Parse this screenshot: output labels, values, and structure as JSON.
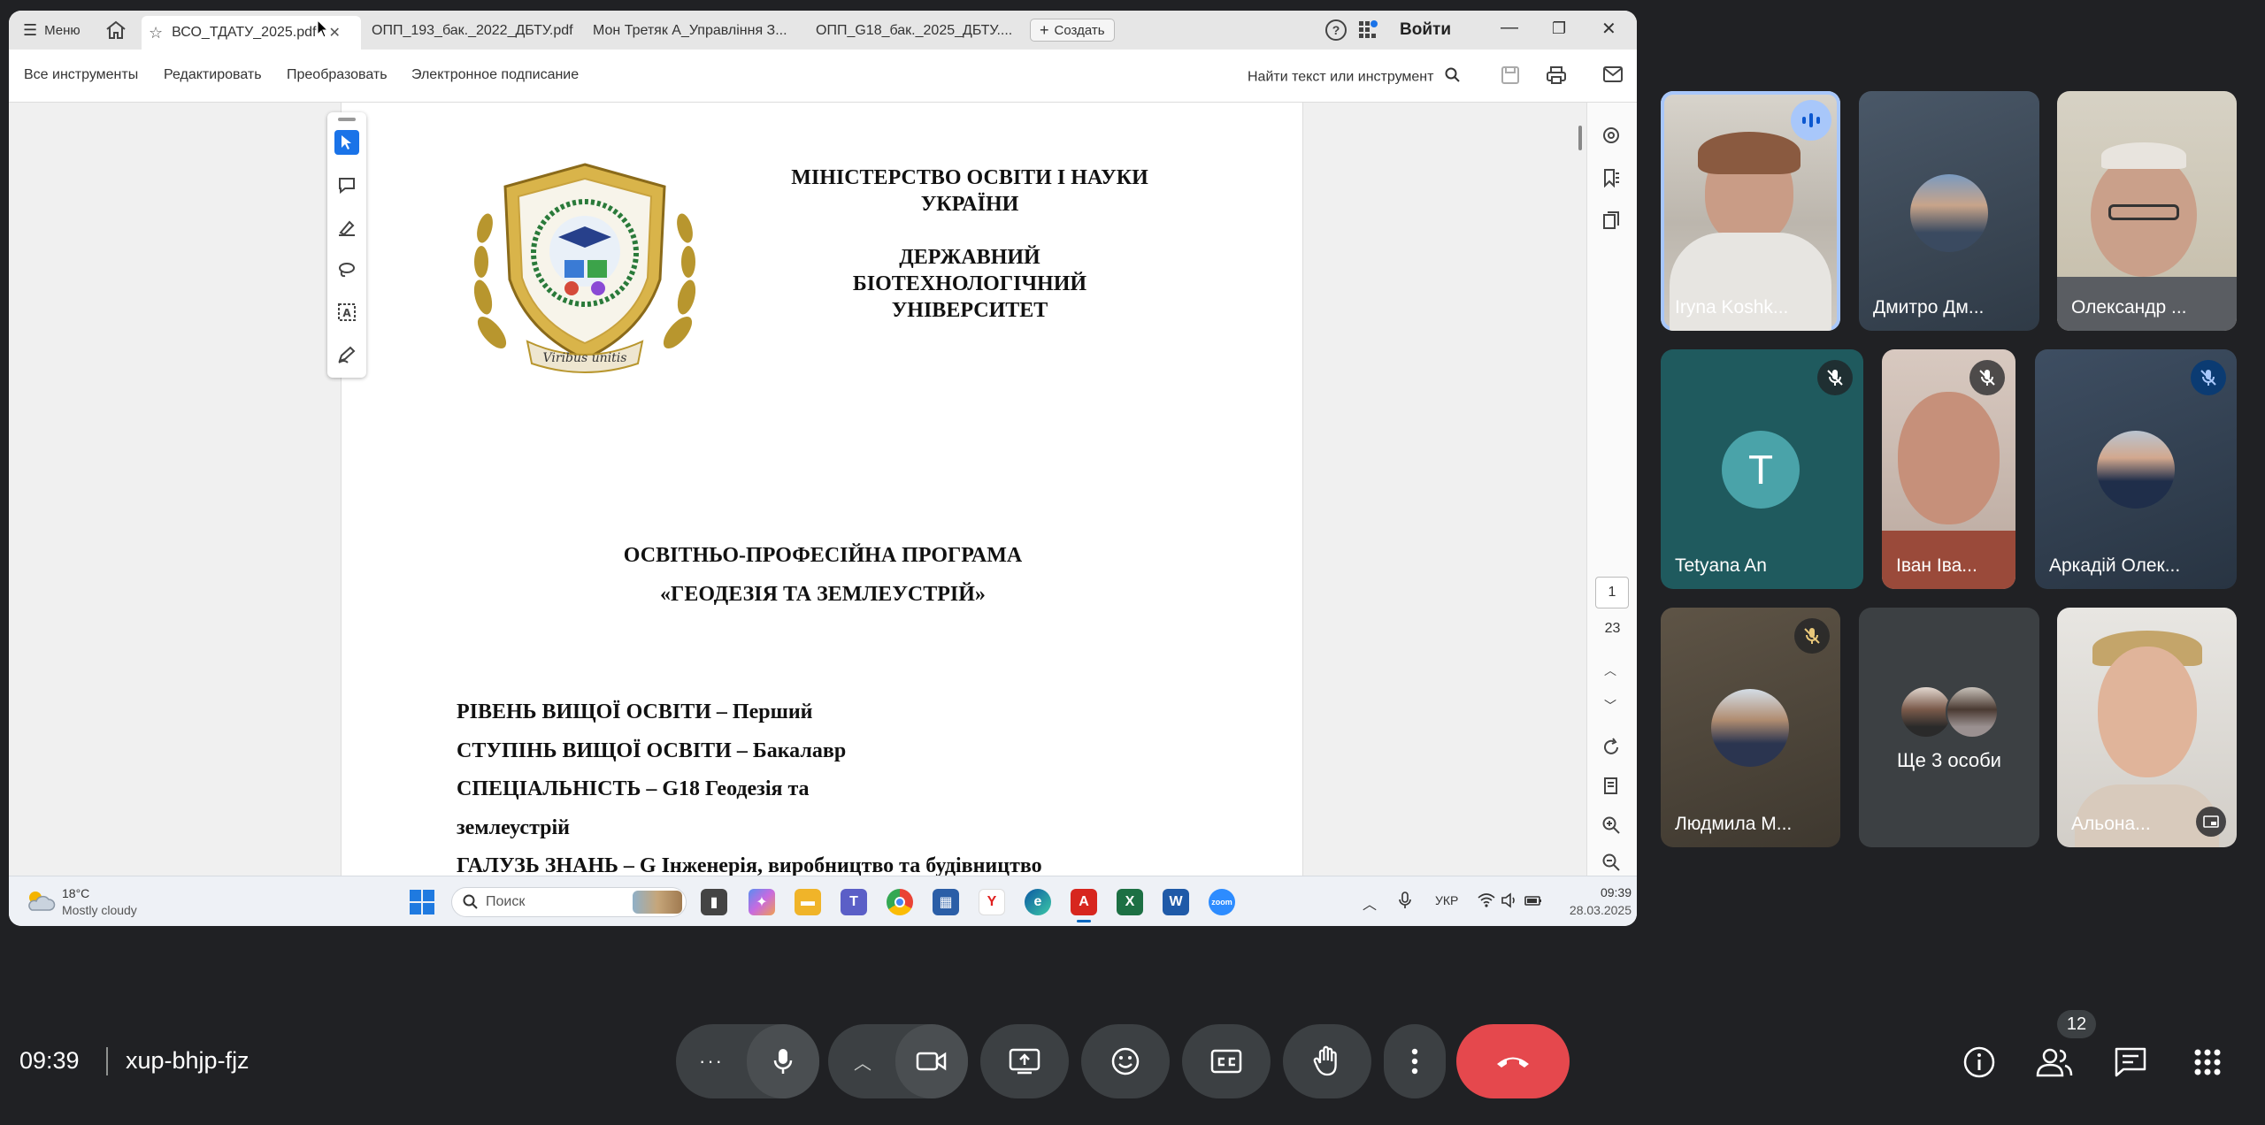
{
  "window": {
    "menu_label": "Меню",
    "tabs": [
      {
        "label": "ВСО_ТДАТУ_2025.pdf"
      },
      {
        "label": "ОПП_193_бак._2022_ДБТУ.pdf"
      },
      {
        "label": "Мон Третяк А_Управління З..."
      },
      {
        "label": "ОПП_G18_бак._2025_ДБТУ...."
      }
    ],
    "create_label": "Создать",
    "signin_label": "Войти"
  },
  "toolbar": {
    "items": [
      "Все инструменты",
      "Редактировать",
      "Преобразовать",
      "Электронное подписание"
    ],
    "search_label": "Найти текст или инструмент"
  },
  "document": {
    "logo_motto": "Viribus unitis",
    "ministry_lines": [
      "МІНІСТЕРСТВО ОСВІТИ І НАУКИ",
      "УКРАЇНИ"
    ],
    "university_lines": [
      "ДЕРЖАВНИЙ",
      "БІОТЕХНОЛОГІЧНИЙ",
      "УНІВЕРСИТЕТ"
    ],
    "program_lines": [
      "ОСВІТНЬО-ПРОФЕСІЙНА ПРОГРАМА",
      "«ГЕОДЕЗІЯ ТА ЗЕМЛЕУСТРІЙ»"
    ],
    "details": [
      "РІВЕНЬ ВИЩОЇ ОСВІТИ – Перший",
      "СТУПІНЬ ВИЩОЇ ОСВІТИ – Бакалавр",
      "СПЕЦІАЛЬНІСТЬ – G18 Геодезія та",
      "землеустрій",
      "ГАЛУЗЬ ЗНАНЬ – G Інженерія, виробництво та будівництво"
    ],
    "current_page": "1",
    "total_pages": "23"
  },
  "taskbar": {
    "weather_temp": "18°C",
    "weather_desc": "Mostly cloudy",
    "search_placeholder": "Поиск",
    "language": "УКР",
    "time": "09:39",
    "date": "28.03.2025"
  },
  "participants": [
    {
      "name": "Iryna Koshk...",
      "speaking": true,
      "muted": false
    },
    {
      "name": "Дмитро Дм...",
      "muted": false
    },
    {
      "name": "Олександр ...",
      "muted": false
    },
    {
      "name": "Tetyana An",
      "initial": "T",
      "muted": true
    },
    {
      "name": "Іван Іва...",
      "muted": true
    },
    {
      "name": "Аркадій Олек...",
      "muted": true
    },
    {
      "name": "Людмила М...",
      "muted": true
    },
    {
      "name": "Ще 3 особи"
    },
    {
      "name": "Альона..."
    }
  ],
  "meeting": {
    "time": "09:39",
    "code": "xup-bhjp-fjz",
    "people_count": "12"
  },
  "colors": {
    "end_call": "#e5484d",
    "active_speaker_border": "#a8c7fa",
    "tetyana_avatar": "#4aa3a9",
    "acrobat_red": "#d7261e"
  }
}
